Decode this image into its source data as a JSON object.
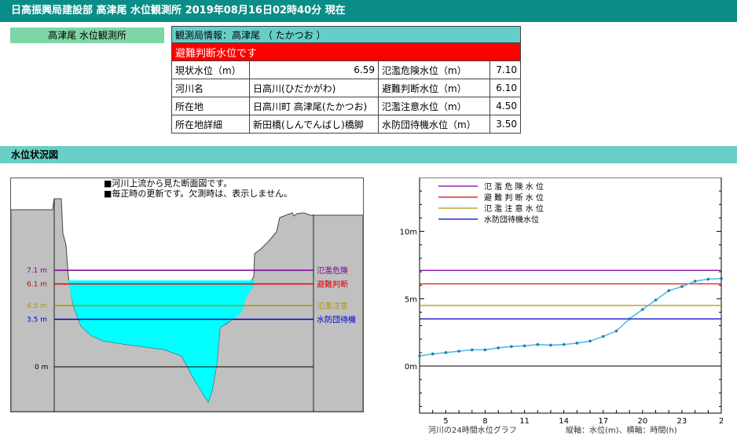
{
  "header": {
    "title": "日高振興局建設部 高津尾 水位観測所 2019年08月16日02時40分 現在"
  },
  "station_tab": {
    "label": "高津尾 水位観測所"
  },
  "info": {
    "title": "観測局情報：高津尾 （ たかつお ）",
    "alert": "避難判断水位です",
    "rows": [
      {
        "label": "現状水位（m）",
        "value": "6.59",
        "label2": "氾濫危険水位（m）",
        "value2": "7.10"
      },
      {
        "label": "河川名",
        "value": "日高川(ひだかがわ)",
        "label2": "避難判断水位（m）",
        "value2": "6.10"
      },
      {
        "label": "所在地",
        "value": "日高川町 高津尾(たかつお)",
        "label2": "氾濫注意水位（m）",
        "value2": "4.50"
      },
      {
        "label": "所在地詳細",
        "value": "新田橋(しんでんばし)橋脚",
        "label2": "水防団待機水位（m）",
        "value2": "3.50"
      }
    ]
  },
  "section": {
    "title": "水位状況図"
  },
  "cross_section": {
    "note1": "■河川上流から見た断面図です。",
    "note2": "■毎正時の更新です。欠測時は、表示しません。",
    "levels": [
      {
        "label": "7.1 m",
        "name": "氾濫危険",
        "value": 7.1,
        "color": "#7b0099"
      },
      {
        "label": "6.1 m",
        "name": "避難判断",
        "value": 6.1,
        "color": "#e00000"
      },
      {
        "label": "4.5 m",
        "name": "氾濫注意",
        "value": 4.5,
        "color": "#b39400"
      },
      {
        "label": "3.5 m",
        "name": "水防団待機",
        "value": 3.5,
        "color": "#0000cc"
      }
    ],
    "zero_label": "0 m",
    "colors": {
      "ground": "#c0c0c0",
      "water": "#00ffff"
    }
  },
  "chart_data": {
    "type": "line",
    "x": [
      3,
      4,
      5,
      6,
      7,
      8,
      9,
      10,
      11,
      12,
      13,
      14,
      15,
      16,
      17,
      18,
      19,
      20,
      21,
      22,
      23,
      24,
      25,
      26
    ],
    "x_ticks": [
      "5",
      "8",
      "11",
      "14",
      "17",
      "20",
      "23",
      "2"
    ],
    "y_tick_labels": [
      "10m",
      "5m",
      "0m"
    ],
    "values": [
      0.75,
      0.9,
      1.0,
      1.1,
      1.2,
      1.2,
      1.35,
      1.45,
      1.5,
      1.6,
      1.55,
      1.6,
      1.7,
      1.85,
      2.2,
      2.6,
      3.5,
      4.2,
      4.9,
      5.6,
      5.9,
      6.3,
      6.45,
      6.5
    ],
    "ylim": [
      -3.5,
      14
    ],
    "series_color": "#4ab7e6",
    "reference_lines": [
      {
        "name": "氾 濫 危 険 水 位",
        "value": 7.1,
        "color": "#7b0099"
      },
      {
        "name": "避 難 判 断 水 位",
        "value": 6.1,
        "color": "#e00000"
      },
      {
        "name": "氾 濫 注 意 水 位",
        "value": 4.5,
        "color": "#b39400"
      },
      {
        "name": "水防団待機水位",
        "value": 3.5,
        "color": "#0000cc"
      }
    ],
    "caption_left": "河川の24時間水位グラフ",
    "caption_right": "縦軸：水位(m)、横軸：時間(h)",
    "grid": false
  }
}
